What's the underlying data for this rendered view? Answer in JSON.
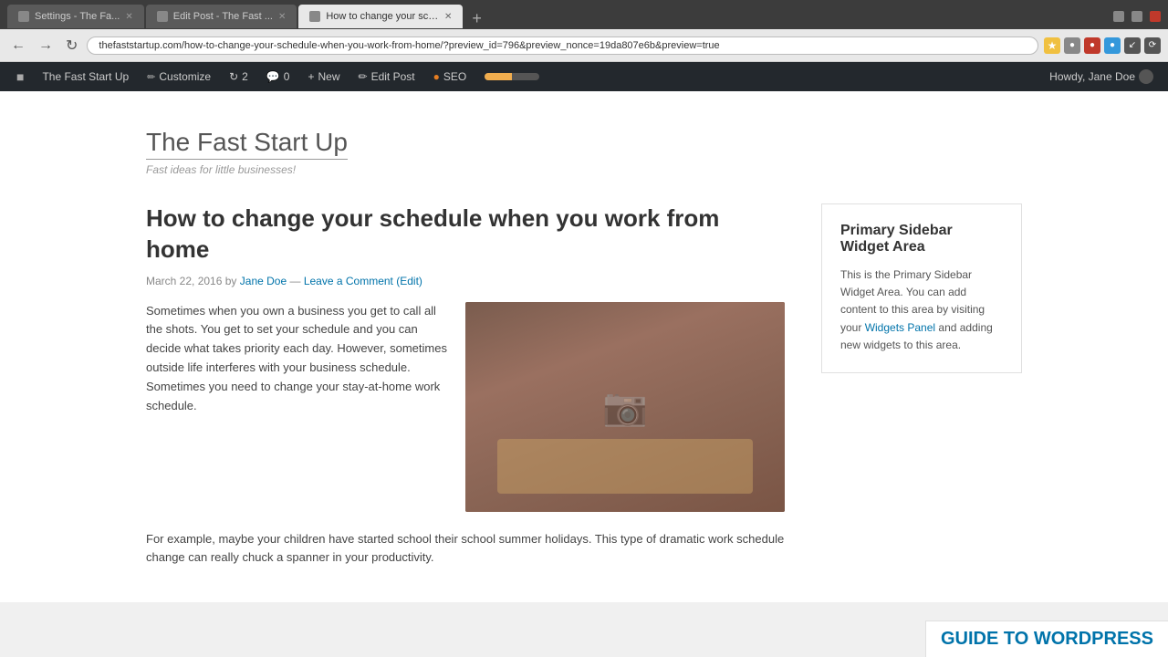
{
  "browser": {
    "tabs": [
      {
        "id": "tab1",
        "label": "Settings - The Fa...",
        "active": false,
        "favicon": "gear"
      },
      {
        "id": "tab2",
        "label": "Edit Post - The Fast ...",
        "active": false,
        "favicon": "wp"
      },
      {
        "id": "tab3",
        "label": "How to change your sch...",
        "active": true,
        "favicon": "wp"
      }
    ],
    "address": "thefaststartup.com/how-to-change-your-schedule-when-you-work-from-home/?preview_id=796&preview_nonce=19da807e6b&preview=true",
    "window_controls": [
      "minimize",
      "maximize",
      "close"
    ]
  },
  "wp_admin_bar": {
    "site_name": "The Fast Start Up",
    "customize_label": "Customize",
    "revisions_count": "2",
    "comments_count": "0",
    "new_label": "New",
    "edit_post_label": "Edit Post",
    "seo_label": "SEO",
    "howdy_text": "Howdy, Jane Doe"
  },
  "site": {
    "title": "The Fast Start Up",
    "tagline": "Fast ideas for little businesses!"
  },
  "article": {
    "title": "How to change your schedule when you work from home",
    "meta_date": "March 22, 2016",
    "meta_by": "by",
    "meta_author": "Jane Doe",
    "meta_separator": "—",
    "meta_comment": "Leave a Comment",
    "meta_edit": "(Edit)",
    "paragraph1": "Sometimes when you own a business you get to call all the shots. You get to set your schedule and you can decide what takes priority each day. However, sometimes outside life interferes with your business schedule. Sometimes you need to change your stay-at-home work schedule.",
    "paragraph2": "For example, maybe your children have started school their school summer holidays. This type of dramatic work schedule change can really chuck a spanner in your productivity."
  },
  "sidebar": {
    "widget_title": "Primary Sidebar Widget Area",
    "widget_text_before": "This is the Primary Sidebar Widget Area. You can add content to this area by visiting your ",
    "widget_link_text": "Widgets Panel",
    "widget_text_after": " and adding new widgets to this area."
  },
  "guide_banner": {
    "text": "GUIDE TO WORDPRESS"
  }
}
